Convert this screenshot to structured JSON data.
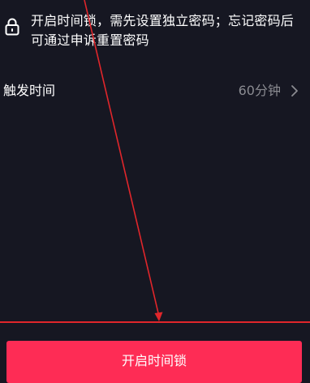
{
  "lock_notice": {
    "icon": "lock-icon",
    "text": "开启时间锁，需先设置独立密码；忘记密码后可通过申诉重置密码"
  },
  "trigger_time": {
    "label": "触发时间",
    "value": "60分钟",
    "icon": "chevron-right-icon"
  },
  "primary_action": {
    "label": "开启时间锁",
    "color": "#fe2c55"
  },
  "annotation": {
    "color": "#e0262b"
  },
  "colors": {
    "background": "#161722",
    "text_primary": "#ffffff",
    "text_secondary": "#8a8b91"
  }
}
